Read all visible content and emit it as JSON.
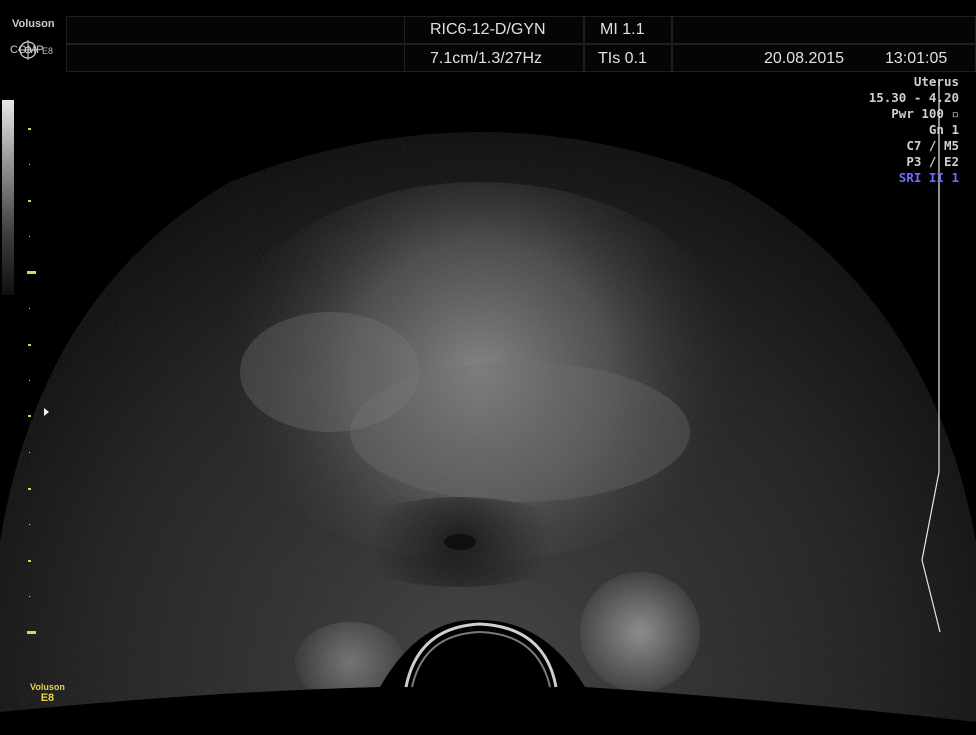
{
  "header": {
    "brand_name": "Voluson",
    "brand_comp": "COMP",
    "brand_model": "E8",
    "probe": "RIC6-12-D/GYN",
    "depth_freq": "7.1cm/1.3/27Hz",
    "mi": "MI  1.1",
    "tis": "TIs  0.1",
    "date": "20.08.2015",
    "time": "13:01:05"
  },
  "readouts": [
    "Uterus",
    "15.30 - 4.20",
    "Pwr 100 ▫",
    "Gn  1",
    "C7 / M5",
    "P3 / E2",
    "SRI II 1"
  ],
  "logo": {
    "line1": "Voluson",
    "line2": "E8"
  },
  "colors": {
    "accent_yellow": "#e6d24a",
    "sri_blue": "#6e6cff",
    "text": "#d8d8d8"
  },
  "icons": [
    "comp-icon",
    "grayscale-bar",
    "depth-scale",
    "tgc-curve"
  ]
}
